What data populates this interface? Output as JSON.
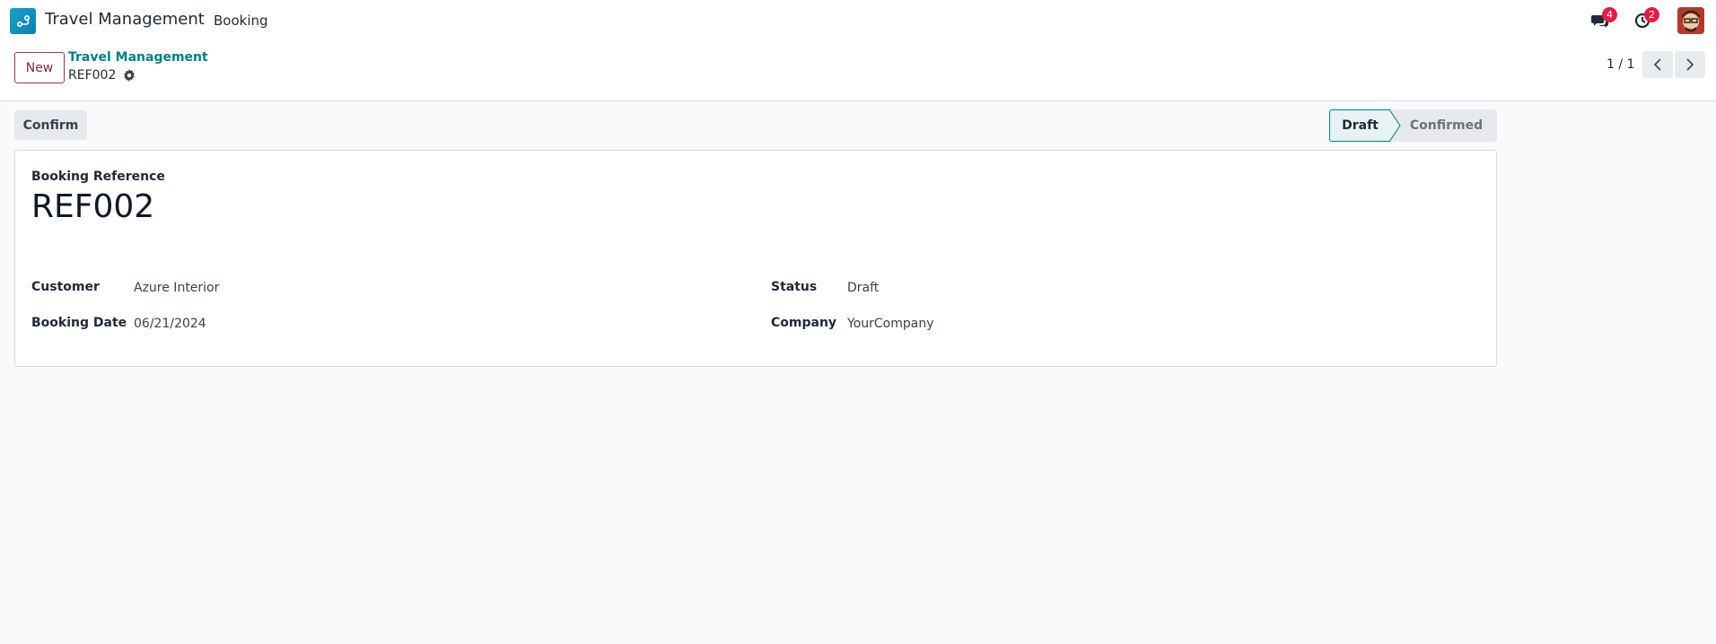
{
  "navbar": {
    "app_name": "Travel Management",
    "menu_booking": "Booking",
    "messages_count": "4",
    "activities_count": "2"
  },
  "control_panel": {
    "new_button": "New",
    "breadcrumb": "Travel Management",
    "record_name": "REF002",
    "pager": "1 / 1"
  },
  "statusbar": {
    "confirm_button": "Confirm",
    "stages": [
      "Draft",
      "Confirmed"
    ],
    "active_stage": "Draft"
  },
  "form": {
    "booking_reference_label": "Booking Reference",
    "booking_reference_value": "REF002",
    "customer_label": "Customer",
    "customer_value": "Azure Interior",
    "booking_date_label": "Booking Date",
    "booking_date_value": "06/21/2024",
    "status_label": "Status",
    "status_value": "Draft",
    "company_label": "Company",
    "company_value": "YourCompany"
  },
  "colors": {
    "accent": "#017e84",
    "new_button_border": "#8f3a4e",
    "badge": "#e11d48",
    "background": "#f9fafb"
  }
}
